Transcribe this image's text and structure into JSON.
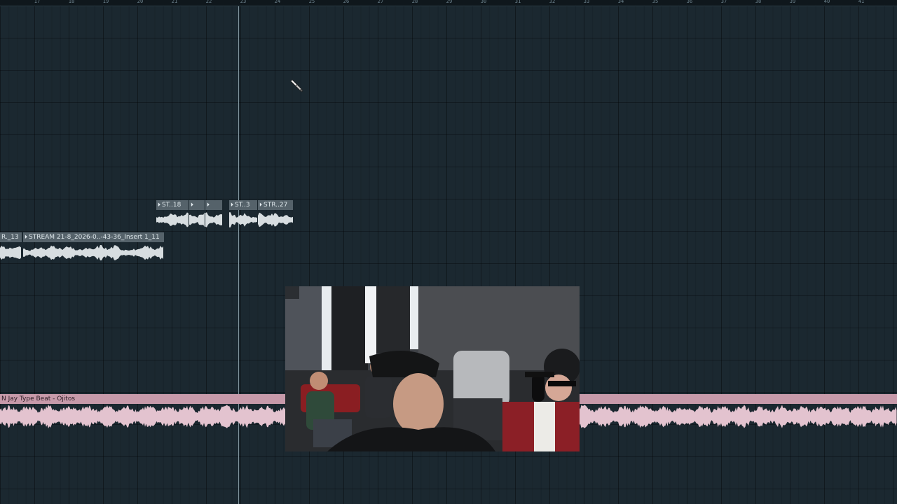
{
  "ruler": {
    "labels": [
      "17",
      "18",
      "19",
      "20",
      "21",
      "22",
      "23",
      "24",
      "25",
      "26",
      "27",
      "28",
      "29",
      "30",
      "31",
      "32",
      "33",
      "34",
      "35",
      "36",
      "37",
      "38",
      "39",
      "40",
      "41"
    ]
  },
  "clips": {
    "clip_13": {
      "title": "R._13"
    },
    "stream_main": {
      "title": "STREAM 21-8_2026-0..-43-36_Insert 1_11"
    },
    "st18": {
      "title": "ST..18"
    },
    "st_blank_a": {
      "title": ""
    },
    "st_blank_b": {
      "title": ""
    },
    "st3": {
      "title": "ST..3"
    },
    "str27": {
      "title": "STR..27"
    },
    "beat": {
      "title": "N Jay Type Beat - Ojitos"
    }
  },
  "colors": {
    "grid_bg": "#1b2830",
    "audio_clip_header": "#55626a",
    "audio_wave": "#d7dde0",
    "beat_clip": "#c79aaa"
  },
  "icons": {
    "cursor": "paint-brush-cursor-icon",
    "clip_play": "play-marker-icon"
  }
}
